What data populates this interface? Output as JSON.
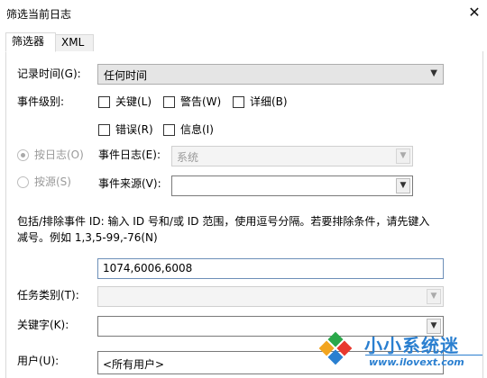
{
  "window": {
    "title": "筛选当前日志",
    "close_glyph": "✕"
  },
  "tabs": [
    {
      "label": "筛选器",
      "active": true
    },
    {
      "label": "XML",
      "active": false
    }
  ],
  "logged": {
    "label": "记录时间(G):",
    "value": "任何时间"
  },
  "event_level": {
    "label": "事件级别:",
    "items": [
      {
        "label": "关键(L)",
        "checked": false
      },
      {
        "label": "警告(W)",
        "checked": false
      },
      {
        "label": "详细(B)",
        "checked": false
      },
      {
        "label": "错误(R)",
        "checked": false
      },
      {
        "label": "信息(I)",
        "checked": false
      }
    ]
  },
  "by_log": {
    "radio_label": "按日志(O)",
    "field_label": "事件日志(E):",
    "value": "系统",
    "selected": true
  },
  "by_source": {
    "radio_label": "按源(S)",
    "field_label": "事件来源(V):",
    "value": "",
    "selected": false
  },
  "event_ids": {
    "description_line1": "包括/排除事件 ID: 输入 ID 号和/或 ID 范围，使用逗号分隔。若要排除条件，请先键入",
    "description_line2": "减号。例如 1,3,5-99,-76(N)",
    "value": "1074,6006,6008"
  },
  "task_category": {
    "label": "任务类别(T):",
    "value": ""
  },
  "keywords": {
    "label": "关键字(K):",
    "value": ""
  },
  "user": {
    "label": "用户(U):",
    "value": "<所有用户>"
  },
  "watermark": {
    "brand": "小小系统迷",
    "url": "www.ilovext.com"
  },
  "colors": {
    "accent": "#2a7fd0",
    "disabled_text": "#9a9a9a",
    "field_border": "#7a7a7a"
  }
}
